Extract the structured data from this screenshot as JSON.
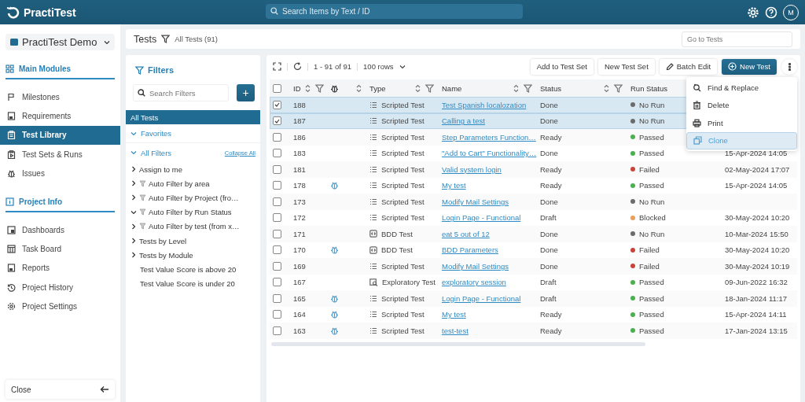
{
  "topbar": {
    "logo": "PractiTest",
    "search": {
      "placeholder": "Search Items by Text / ID"
    },
    "avatar": "M"
  },
  "sidebar": {
    "project": "PractiTest Demo",
    "sections": [
      {
        "title": "Main Modules",
        "kind": "modules",
        "items": [
          {
            "label": "Milestones",
            "kind": "flag",
            "selected": false
          },
          {
            "label": "Requirements",
            "kind": "doc",
            "selected": false
          },
          {
            "label": "Test Library",
            "kind": "clipboard",
            "selected": true
          },
          {
            "label": "Test Sets & Runs",
            "kind": "play",
            "selected": false
          },
          {
            "label": "Issues",
            "kind": "bug",
            "selected": false
          }
        ]
      },
      {
        "title": "Project Info",
        "kind": "info",
        "items": [
          {
            "label": "Dashboards",
            "kind": "dash",
            "selected": false
          },
          {
            "label": "Task Board",
            "kind": "board",
            "selected": false
          },
          {
            "label": "Reports",
            "kind": "doc",
            "selected": false
          },
          {
            "label": "Project History",
            "kind": "history",
            "selected": false
          },
          {
            "label": "Project Settings",
            "kind": "gear",
            "selected": false
          }
        ]
      }
    ],
    "close": "Close"
  },
  "header": {
    "title": "Tests",
    "filter": "All Tests (91)",
    "goto": {
      "placeholder": "Go to Tests"
    }
  },
  "filters": {
    "title": "Filters",
    "search": {
      "placeholder": "Search Filters"
    },
    "add": "+",
    "all_tests": {
      "label": "All Tests",
      "selected": true
    },
    "favorites": {
      "label": "Favorites",
      "expanded": true
    },
    "all_filters": {
      "label": "All Filters",
      "expanded": true,
      "collapse": "Collapse All"
    },
    "items": [
      {
        "label": "Assign to me",
        "kind": "group",
        "expanded": false,
        "auto": false
      },
      {
        "label": "Auto Filter by area",
        "kind": "group",
        "expanded": false,
        "auto": true
      },
      {
        "label": "Auto Filter by Project (fro…",
        "kind": "group",
        "expanded": false,
        "auto": true
      },
      {
        "label": "Auto Filter by Run Status",
        "kind": "group",
        "expanded": true,
        "auto": true
      },
      {
        "label": "Auto Filter by test (from x…",
        "kind": "group",
        "expanded": false,
        "auto": true
      },
      {
        "label": "Tests by Level",
        "kind": "group",
        "expanded": false,
        "auto": false
      },
      {
        "label": "Tests by Module",
        "kind": "group",
        "expanded": false,
        "auto": false
      },
      {
        "label": "Test Value Score is above 20",
        "kind": "leaf",
        "auto": false
      },
      {
        "label": "Test Value Score is under 20",
        "kind": "leaf",
        "auto": false
      }
    ]
  },
  "table": {
    "range": "1 - 91 of 91",
    "page_size": "100 rows",
    "all_checked": false,
    "actions": [
      {
        "label": "Add to Test Set",
        "kind": "plain"
      },
      {
        "label": "New Test Set",
        "kind": "plain"
      },
      {
        "label": "Batch Edit",
        "kind": "edit"
      },
      {
        "label": "New Test",
        "kind": "primary"
      }
    ],
    "columns": [
      {
        "label": "ID",
        "sort": true,
        "filter": true
      },
      {
        "kind": "bug",
        "sort": true,
        "filter": false
      },
      {
        "label": "Type",
        "sort": true,
        "filter": true
      },
      {
        "label": "Name",
        "sort": true,
        "filter": true
      },
      {
        "label": "Status",
        "sort": true,
        "filter": true
      },
      {
        "label": "Run Status",
        "sort": false,
        "filter": false
      }
    ],
    "rows": [
      {
        "checked": true,
        "id": "188",
        "bug": false,
        "kind": "scripted",
        "type": "Scripted Test",
        "name": "Test Spanish localozation",
        "status": "Done",
        "run_status": "No Run",
        "color": "#6b6b6b"
      },
      {
        "checked": true,
        "id": "187",
        "bug": false,
        "kind": "scripted",
        "type": "Scripted Test",
        "name": "Calling a test",
        "status": "Done",
        "run_status": "No Run",
        "color": "#6b6b6b"
      },
      {
        "checked": false,
        "id": "186",
        "bug": false,
        "kind": "scripted",
        "type": "Scripted Test",
        "name": "Step Parameters Function…",
        "status": "Ready",
        "run_status": "Passed",
        "color": "#4caf50"
      },
      {
        "checked": false,
        "id": "183",
        "bug": false,
        "kind": "scripted",
        "type": "Scripted Test",
        "name": "\"Add to Cart\" Functionality…",
        "status": "Done",
        "run_status": "Passed",
        "color": "#4caf50",
        "date": "15-Apr-2024 14:05"
      },
      {
        "checked": false,
        "id": "181",
        "bug": false,
        "kind": "scripted",
        "type": "Scripted Test",
        "name": "Valid system login",
        "status": "Ready",
        "run_status": "Failed",
        "color": "#c9453a",
        "date": "02-May-2024 17:07"
      },
      {
        "checked": false,
        "id": "178",
        "bug": true,
        "kind": "scripted",
        "type": "Scripted Test",
        "name": "My test",
        "status": "Ready",
        "run_status": "Passed",
        "color": "#4caf50",
        "date": "15-Apr-2024 14:05"
      },
      {
        "checked": false,
        "id": "173",
        "bug": false,
        "kind": "scripted",
        "type": "Scripted Test",
        "name": "Modify Mail Settings",
        "status": "Done",
        "run_status": "No Run",
        "color": "#6b6b6b"
      },
      {
        "checked": false,
        "id": "172",
        "bug": false,
        "kind": "scripted",
        "type": "Scripted Test",
        "name": "Login Page - Functional",
        "status": "Draft",
        "run_status": "Blocked",
        "color": "#eba05a",
        "date": "30-May-2024 10:20"
      },
      {
        "checked": false,
        "id": "171",
        "bug": false,
        "kind": "bdd",
        "type": "BDD Test",
        "name": "eat 5 out of 12",
        "status": "Done",
        "run_status": "No Run",
        "color": "#6b6b6b",
        "date": "10-Mar-2024 15:50"
      },
      {
        "checked": false,
        "id": "170",
        "bug": true,
        "kind": "bdd",
        "type": "BDD Test",
        "name": "BDD Parameters",
        "status": "Done",
        "run_status": "Failed",
        "color": "#c9453a",
        "date": "30-May-2024 10:20"
      },
      {
        "checked": false,
        "id": "169",
        "bug": false,
        "kind": "scripted",
        "type": "Scripted Test",
        "name": "Modify Mail Settings",
        "status": "Done",
        "run_status": "Failed",
        "color": "#c9453a",
        "date": "30-May-2024 10:19"
      },
      {
        "checked": false,
        "id": "167",
        "bug": false,
        "kind": "exploratory",
        "type": "Exploratory Test",
        "name": "exploratory session",
        "status": "Draft",
        "run_status": "Passed",
        "color": "#4caf50",
        "date": "09-Jun-2022 16:32"
      },
      {
        "checked": false,
        "id": "165",
        "bug": true,
        "kind": "scripted",
        "type": "Scripted Test",
        "name": "Login Page - Functional",
        "status": "Draft",
        "run_status": "Passed",
        "color": "#4caf50",
        "date": "18-Jan-2024 11:17"
      },
      {
        "checked": false,
        "id": "164",
        "bug": true,
        "kind": "scripted",
        "type": "Scripted Test",
        "name": "My test",
        "status": "Ready",
        "run_status": "Passed",
        "color": "#4caf50",
        "date": "15-Apr-2024 14:11"
      },
      {
        "checked": false,
        "id": "163",
        "bug": true,
        "kind": "scripted",
        "type": "Scripted Test",
        "name": "test-test",
        "status": "Ready",
        "run_status": "Passed",
        "color": "#4caf50",
        "date": "17-Jan-2024 13:15"
      }
    ]
  },
  "menu": {
    "items": [
      {
        "label": "Find & Replace",
        "kind": "find",
        "selected": false
      },
      {
        "label": "Delete",
        "kind": "trash",
        "selected": false
      },
      {
        "label": "Print",
        "kind": "print",
        "selected": false
      },
      {
        "label": "Clone",
        "kind": "clone",
        "selected": true
      }
    ]
  }
}
